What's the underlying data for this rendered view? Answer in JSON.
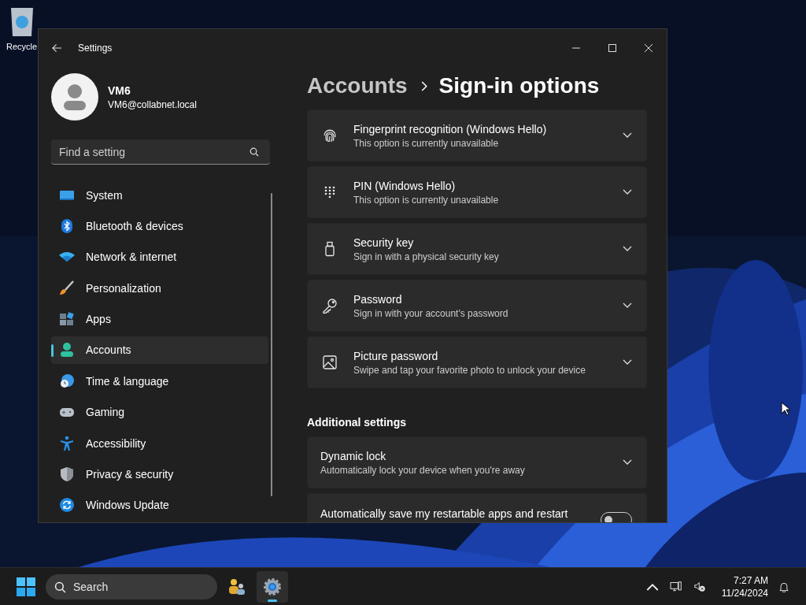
{
  "desktop": {
    "icons": [
      {
        "label": "Recycle"
      }
    ]
  },
  "window": {
    "title": "Settings"
  },
  "profile": {
    "name": "VM6",
    "email": "VM6@collabnet.local"
  },
  "search": {
    "placeholder": "Find a setting"
  },
  "nav": [
    {
      "label": "System",
      "kind": "system",
      "selected": false
    },
    {
      "label": "Bluetooth & devices",
      "kind": "bluetooth",
      "selected": false
    },
    {
      "label": "Network & internet",
      "kind": "network",
      "selected": false
    },
    {
      "label": "Personalization",
      "kind": "brush",
      "selected": false
    },
    {
      "label": "Apps",
      "kind": "apps",
      "selected": false
    },
    {
      "label": "Accounts",
      "kind": "accounts",
      "selected": true
    },
    {
      "label": "Time & language",
      "kind": "time",
      "selected": false
    },
    {
      "label": "Gaming",
      "kind": "gaming",
      "selected": false
    },
    {
      "label": "Accessibility",
      "kind": "accessibility",
      "selected": false
    },
    {
      "label": "Privacy & security",
      "kind": "privacy",
      "selected": false
    },
    {
      "label": "Windows Update",
      "kind": "update",
      "selected": false
    }
  ],
  "breadcrumb": {
    "parent": "Accounts",
    "current": "Sign-in options"
  },
  "sign_in_options": [
    {
      "kind": "fingerprint",
      "title": "Fingerprint recognition (Windows Hello)",
      "description": "This option is currently unavailable"
    },
    {
      "kind": "pin",
      "title": "PIN (Windows Hello)",
      "description": "This option is currently unavailable"
    },
    {
      "kind": "security-key",
      "title": "Security key",
      "description": "Sign in with a physical security key"
    },
    {
      "kind": "password",
      "title": "Password",
      "description": "Sign in with your account's password"
    },
    {
      "kind": "picture-password",
      "title": "Picture password",
      "description": "Swipe and tap your favorite photo to unlock your device"
    }
  ],
  "additional_settings": {
    "heading": "Additional settings",
    "items": [
      {
        "kind": "expander",
        "title": "Dynamic lock",
        "description": "Automatically lock your device when you're away"
      },
      {
        "kind": "toggle",
        "title": "Automatically save my restartable apps and restart",
        "on": false
      }
    ]
  },
  "taskbar": {
    "search_placeholder": "Search",
    "apps": [
      {
        "kind": "people",
        "selected": false
      },
      {
        "kind": "settings",
        "selected": true
      }
    ],
    "time": "7:27 AM",
    "date": "11/24/2024"
  }
}
